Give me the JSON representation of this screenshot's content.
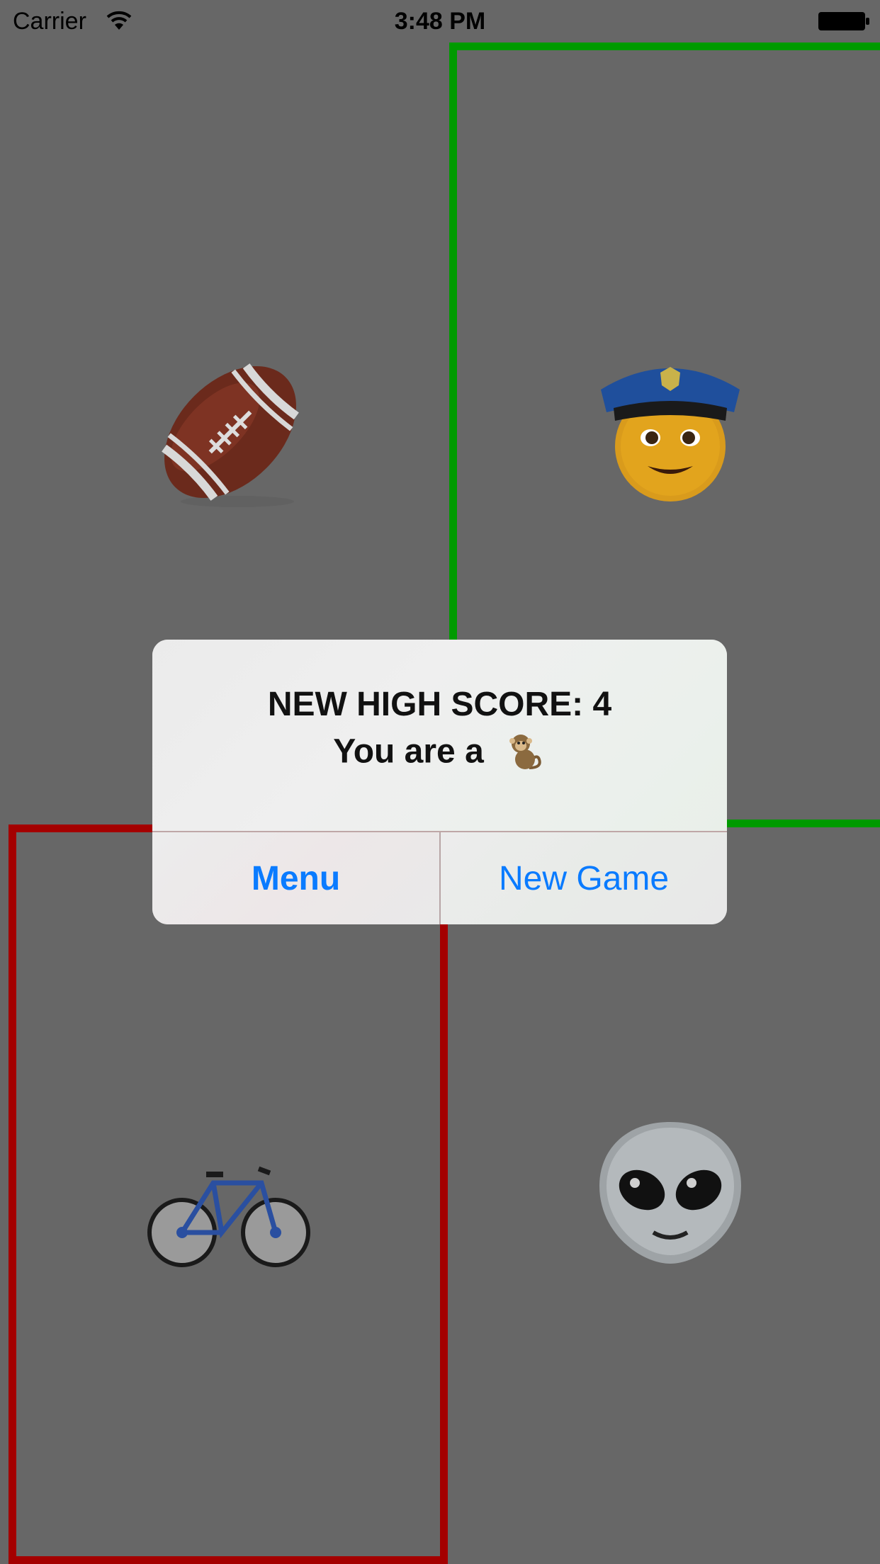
{
  "status_bar": {
    "carrier": "Carrier",
    "time": "3:48 PM",
    "wifi_icon": "wifi-icon",
    "battery_icon": "battery-full-icon"
  },
  "board": {
    "background_color": "#676767",
    "tiles": [
      {
        "emoji": "american-football",
        "highlight": "none"
      },
      {
        "emoji": "police-officer",
        "highlight": "#009a00"
      },
      {
        "emoji": "bicycle",
        "highlight": "#a40000"
      },
      {
        "emoji": "alien",
        "highlight": "none"
      }
    ]
  },
  "alert": {
    "title": "NEW HIGH SCORE: 4",
    "message": "You are a",
    "message_emoji": "monkey",
    "buttons": {
      "menu": "Menu",
      "new_game": "New Game"
    },
    "button_color": "#0a7bff"
  }
}
